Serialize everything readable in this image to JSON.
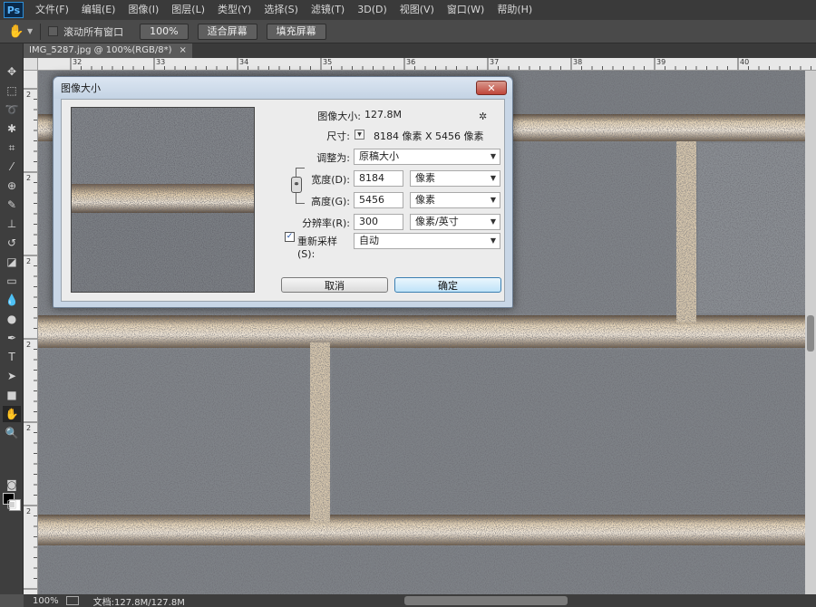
{
  "app": {
    "logo": "Ps"
  },
  "menu": [
    "文件(F)",
    "编辑(E)",
    "图像(I)",
    "图层(L)",
    "类型(Y)",
    "选择(S)",
    "滤镜(T)",
    "3D(D)",
    "视图(V)",
    "窗口(W)",
    "帮助(H)"
  ],
  "options": {
    "scroll_all_label": "滚动所有窗口",
    "zoom_btn": "100%",
    "fit_screen_btn": "适合屏幕",
    "fill_screen_btn": "填充屏幕"
  },
  "document": {
    "tab_title": "IMG_5287.jpg @ 100%(RGB/8*)",
    "tab_close": "×"
  },
  "rulers": {
    "top_ticks": [
      "32",
      "33",
      "34",
      "35",
      "36",
      "37",
      "38",
      "39",
      "40"
    ],
    "left_ticks": [
      "2",
      "2",
      "2",
      "2",
      "2",
      "2"
    ]
  },
  "status": {
    "zoom": "100%",
    "doc_info": "文档:127.8M/127.8M"
  },
  "dialog": {
    "title": "图像大小",
    "close": "✕",
    "image_size_label": "图像大小:",
    "image_size_value": "127.8M",
    "dimensions_label": "尺寸:",
    "dimensions_value": "8184 像素  X  5456 像素",
    "fit_to_label": "调整为:",
    "fit_to_value": "原稿大小",
    "width_label": "宽度(D):",
    "width_value": "8184",
    "width_unit": "像素",
    "height_label": "高度(G):",
    "height_value": "5456",
    "height_unit": "像素",
    "resolution_label": "分辨率(R):",
    "resolution_value": "300",
    "resolution_unit": "像素/英寸",
    "resample_label": "重新采样(S):",
    "resample_checked": true,
    "resample_value": "自动",
    "cancel_label": "取消",
    "ok_label": "确定"
  }
}
